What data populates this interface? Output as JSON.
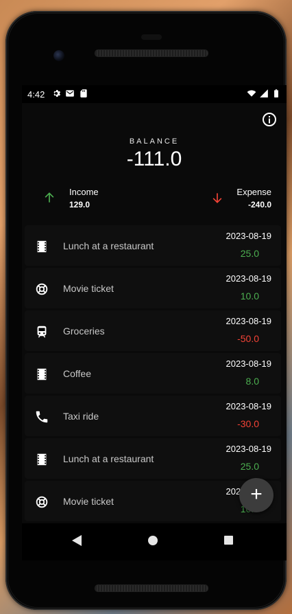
{
  "status": {
    "time": "4:42",
    "left_icons": [
      "settings-icon",
      "gmail-icon",
      "sd-card-icon"
    ],
    "right_icons": [
      "wifi-icon",
      "signal-icon",
      "battery-icon"
    ]
  },
  "header": {
    "info_icon": "info-icon",
    "balance_label": "BALANCE",
    "balance_value": "-111.0"
  },
  "summary": {
    "income": {
      "label": "Income",
      "value": "129.0",
      "color": "#4caf50",
      "icon": "arrow-up-icon"
    },
    "expense": {
      "label": "Expense",
      "value": "-240.0",
      "color": "#f44336",
      "icon": "arrow-down-icon"
    }
  },
  "transactions": [
    {
      "icon": "film-icon",
      "title": "Lunch at a restaurant",
      "date": "2023-08-19",
      "amount": "25.0",
      "sign": "pos"
    },
    {
      "icon": "lifebuoy-icon",
      "title": "Movie ticket",
      "date": "2023-08-19",
      "amount": "10.0",
      "sign": "pos"
    },
    {
      "icon": "train-icon",
      "title": "Groceries",
      "date": "2023-08-19",
      "amount": "-50.0",
      "sign": "neg"
    },
    {
      "icon": "film-icon",
      "title": "Coffee",
      "date": "2023-08-19",
      "amount": "8.0",
      "sign": "pos"
    },
    {
      "icon": "phone-icon",
      "title": "Taxi ride",
      "date": "2023-08-19",
      "amount": "-30.0",
      "sign": "neg"
    },
    {
      "icon": "film-icon",
      "title": "Lunch at a restaurant",
      "date": "2023-08-19",
      "amount": "25.0",
      "sign": "pos"
    },
    {
      "icon": "lifebuoy-icon",
      "title": "Movie ticket",
      "date": "2023-08-19",
      "amount": "10.0",
      "sign": "pos"
    }
  ],
  "fab": {
    "label": "+"
  },
  "colors": {
    "positive": "#4caf50",
    "negative": "#f44336",
    "background": "#0a0a0a"
  }
}
